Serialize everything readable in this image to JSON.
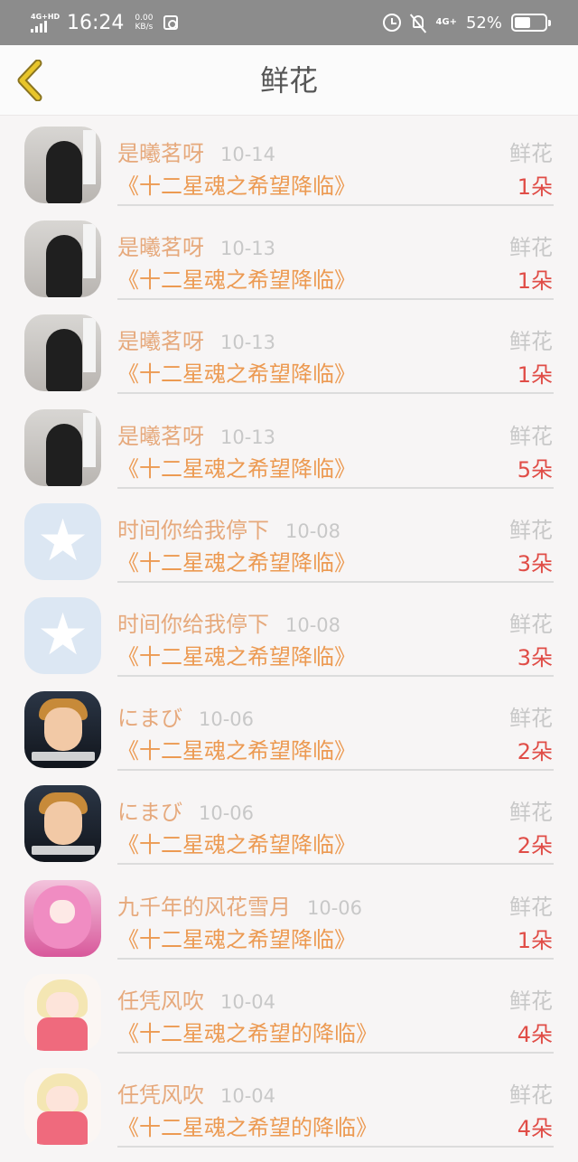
{
  "status_bar": {
    "network_left": "4G+HD",
    "time": "16:24",
    "speed_value": "0.00",
    "speed_unit": "KB/s",
    "network_right": "4G+",
    "battery_text": "52%",
    "battery_level": 0.52
  },
  "header": {
    "title": "鲜花"
  },
  "gifts": [
    {
      "name": "是曦茗呀",
      "date": "10-14",
      "book": "《十二星魂之希望降临》",
      "gift": "鲜花",
      "count": "1朵",
      "avatar": "girl-photo"
    },
    {
      "name": "是曦茗呀",
      "date": "10-13",
      "book": "《十二星魂之希望降临》",
      "gift": "鲜花",
      "count": "1朵",
      "avatar": "girl-photo"
    },
    {
      "name": "是曦茗呀",
      "date": "10-13",
      "book": "《十二星魂之希望降临》",
      "gift": "鲜花",
      "count": "1朵",
      "avatar": "girl-photo"
    },
    {
      "name": "是曦茗呀",
      "date": "10-13",
      "book": "《十二星魂之希望降临》",
      "gift": "鲜花",
      "count": "5朵",
      "avatar": "girl-photo"
    },
    {
      "name": "时间你给我停下",
      "date": "10-08",
      "book": "《十二星魂之希望降临》",
      "gift": "鲜花",
      "count": "3朵",
      "avatar": "qq-default"
    },
    {
      "name": "时间你给我停下",
      "date": "10-08",
      "book": "《十二星魂之希望降临》",
      "gift": "鲜花",
      "count": "3朵",
      "avatar": "qq-default"
    },
    {
      "name": "にまび",
      "date": "10-06",
      "book": "《十二星魂之希望降临》",
      "gift": "鲜花",
      "count": "2朵",
      "avatar": "cartoon-princess"
    },
    {
      "name": "にまび",
      "date": "10-06",
      "book": "《十二星魂之希望降临》",
      "gift": "鲜花",
      "count": "2朵",
      "avatar": "cartoon-princess"
    },
    {
      "name": "九千年的风花雪月",
      "date": "10-06",
      "book": "《十二星魂之希望降临》",
      "gift": "鲜花",
      "count": "1朵",
      "avatar": "pink-anime"
    },
    {
      "name": "任凭风吹",
      "date": "10-04",
      "book": "《十二星魂之希望的降临》",
      "gift": "鲜花",
      "count": "4朵",
      "avatar": "anime-girl"
    },
    {
      "name": "任凭风吹",
      "date": "10-04",
      "book": "《十二星魂之希望的降临》",
      "gift": "鲜花",
      "count": "4朵",
      "avatar": "anime-girl"
    }
  ],
  "colors": {
    "status_bar": "#8c8c8c",
    "name": "#e6a97c",
    "book": "#ec9a52",
    "count": "#e04d47",
    "muted": "#c8c8c8",
    "back_arrow": "#e8c52a"
  }
}
